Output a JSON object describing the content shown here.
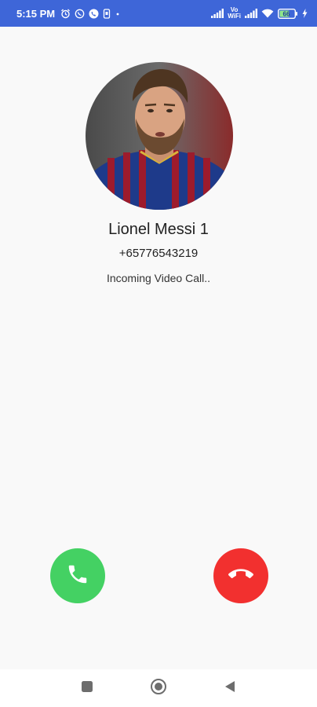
{
  "status_bar": {
    "time": "5:15 PM",
    "network_label_top": "Vo",
    "network_label_bottom": "WiFi",
    "battery_level": "66",
    "left_icons": [
      "alarm-icon",
      "whatsapp-icon",
      "phone-call-icon",
      "sim-icon",
      "dot-icon"
    ],
    "right_icons": [
      "signal-icon",
      "volte-icon",
      "signal-icon",
      "wifi-icon",
      "battery-icon",
      "charging-icon"
    ]
  },
  "caller": {
    "name": "Lionel Messi 1",
    "number": "+65776543219",
    "status": "Incoming Video Call.."
  },
  "actions": {
    "accept_icon": "phone-icon",
    "decline_icon": "phone-hangup-icon",
    "accept_color": "#44d163",
    "decline_color": "#f2302f"
  },
  "nav": {
    "icons": [
      "recents-square-icon",
      "home-circle-icon",
      "back-triangle-icon"
    ]
  }
}
